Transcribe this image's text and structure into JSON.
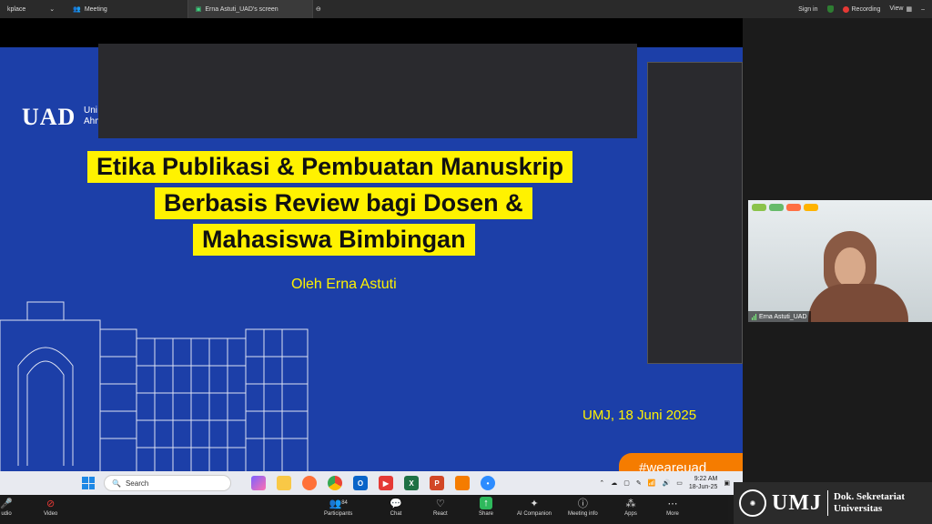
{
  "topbar": {
    "app_name": "kplace",
    "meeting_tab": "Meeting",
    "screen_tab": "Erna Astuti_UAD's screen",
    "signin": "Sign in",
    "recording": "Recording",
    "view": "View"
  },
  "slide": {
    "logo": "UAD",
    "logo_sub1": "Uni",
    "logo_sub2": "Ahm",
    "title_lines": [
      "Etika Publikasi & Pembuatan Manuskrip",
      "Berbasis Review bagi Dosen &",
      "Mahasiswa Bimbingan"
    ],
    "byline": "Oleh Erna Astuti",
    "date": "UMJ, 18 Juni 2025",
    "hashtag": "#weareuad",
    "colors": {
      "background": "#1c3fa8",
      "highlight": "#fff200",
      "hashtag": "#f57c00"
    }
  },
  "taskbar": {
    "search_placeholder": "Search",
    "time": "9:22 AM",
    "date": "18-Jun-25"
  },
  "video": {
    "participant_name": "Erna Astuti_UAD"
  },
  "toolbar": {
    "audio": "udio",
    "video": "Video",
    "participants_count": "84",
    "participants": "Participants",
    "chat": "Chat",
    "react": "React",
    "share": "Share",
    "ai_companion": "AI Companion",
    "meeting_info": "Meeting info",
    "apps": "Apps",
    "more": "More"
  },
  "watermark": {
    "logo": "UMJ",
    "line1": "Dok. Sekretariat",
    "line2": "Universitas"
  }
}
